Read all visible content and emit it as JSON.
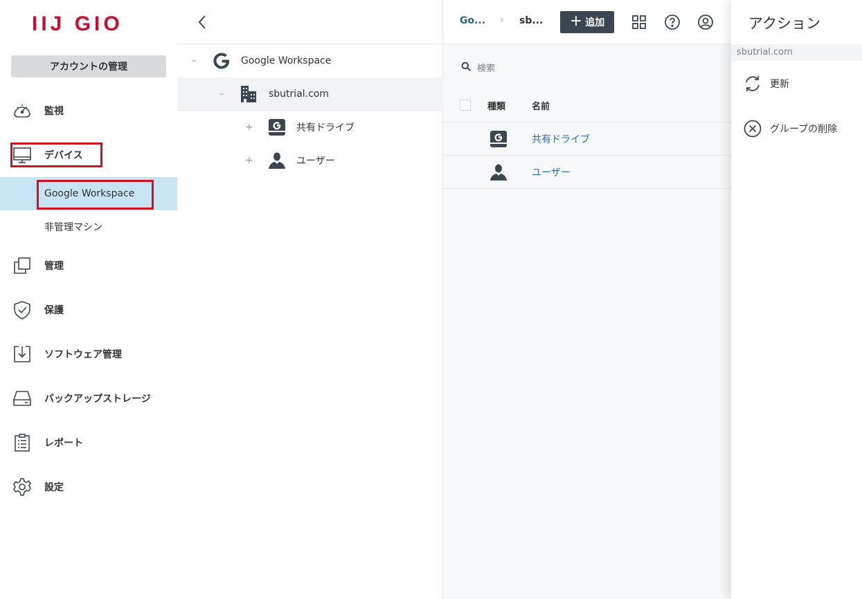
{
  "app": {
    "logo": "IIJ GIO"
  },
  "sidebar": {
    "account_button": "アカウントの管理",
    "items": [
      {
        "label": "監視",
        "icon": "gauge-icon"
      },
      {
        "label": "デバイス",
        "icon": "monitor-icon"
      },
      {
        "label": "Google Workspace",
        "sub": true,
        "active": true
      },
      {
        "label": "非管理マシン",
        "sub": true
      },
      {
        "label": "管理",
        "icon": "copy-squares-icon"
      },
      {
        "label": "保護",
        "icon": "shield-check-icon"
      },
      {
        "label": "ソフトウェア管理",
        "icon": "software-download-icon"
      },
      {
        "label": "バックアップストレージ",
        "icon": "drive-icon"
      },
      {
        "label": "レポート",
        "icon": "clipboard-icon"
      },
      {
        "label": "設定",
        "icon": "gear-icon"
      }
    ]
  },
  "tree": {
    "nodes": [
      {
        "label": "Google Workspace",
        "toggle": "–",
        "icon": "google-g-icon"
      },
      {
        "label": "sbutrial.com",
        "toggle": "–",
        "icon": "building-icon"
      },
      {
        "label": "共有ドライブ",
        "toggle": "+",
        "icon": "shared-drive-icon"
      },
      {
        "label": "ユーザー",
        "toggle": "+",
        "icon": "user-icon"
      }
    ]
  },
  "main": {
    "breadcrumb": [
      "Go...",
      "sb..."
    ],
    "breadcrumb_sep": "›",
    "add_button": "追加",
    "add_plus": "+",
    "search_placeholder": "検索",
    "columns": {
      "type": "種類",
      "name": "名前"
    },
    "rows": [
      {
        "name": "共有ドライブ",
        "icon": "shared-drive-icon"
      },
      {
        "name": "ユーザー",
        "icon": "user-icon"
      }
    ]
  },
  "actions": {
    "title": "アクション",
    "subtitle": "sbutrial.com",
    "items": [
      {
        "label": "更新",
        "icon": "refresh-icon"
      },
      {
        "label": "グループの削除",
        "icon": "delete-circle-x-icon"
      }
    ]
  },
  "colors": {
    "brand_red": "#c8102e",
    "highlight": "#d0121e",
    "active_bg": "#c8e4f5",
    "link": "#2b6cb0"
  }
}
